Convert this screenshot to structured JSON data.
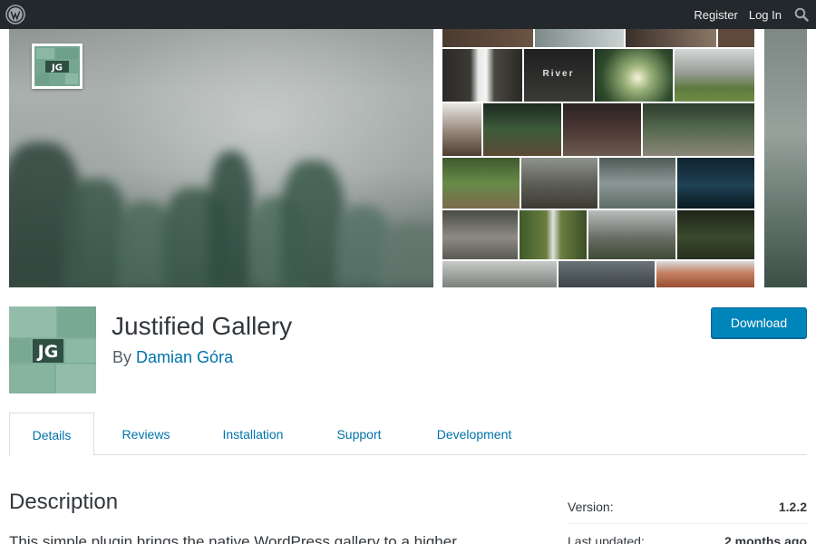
{
  "topbar": {
    "logo_icon": "wordpress-logo-icon",
    "register_label": "Register",
    "login_label": "Log In",
    "search_icon": "search-icon"
  },
  "banner": {
    "logo_text": "JG",
    "collage_caption": "River"
  },
  "plugin": {
    "icon_text": "JG",
    "title": "Justified Gallery",
    "by_label": "By",
    "author": "Damian Góra",
    "download_label": "Download"
  },
  "tabs": [
    {
      "label": "Details",
      "active": true
    },
    {
      "label": "Reviews",
      "active": false
    },
    {
      "label": "Installation",
      "active": false
    },
    {
      "label": "Support",
      "active": false
    },
    {
      "label": "Development",
      "active": false
    }
  ],
  "description": {
    "heading": "Description",
    "text": "This simple plugin brings the native WordPress gallery to a higher"
  },
  "meta": [
    {
      "key": "Version:",
      "value": "1.2.2"
    },
    {
      "key": "Last updated:",
      "value": "2 months ago"
    }
  ],
  "colors": {
    "admin_bar": "#23282d",
    "link_blue": "#0073aa",
    "button_blue": "#0085ba",
    "icon_green": "#7fae9a"
  }
}
